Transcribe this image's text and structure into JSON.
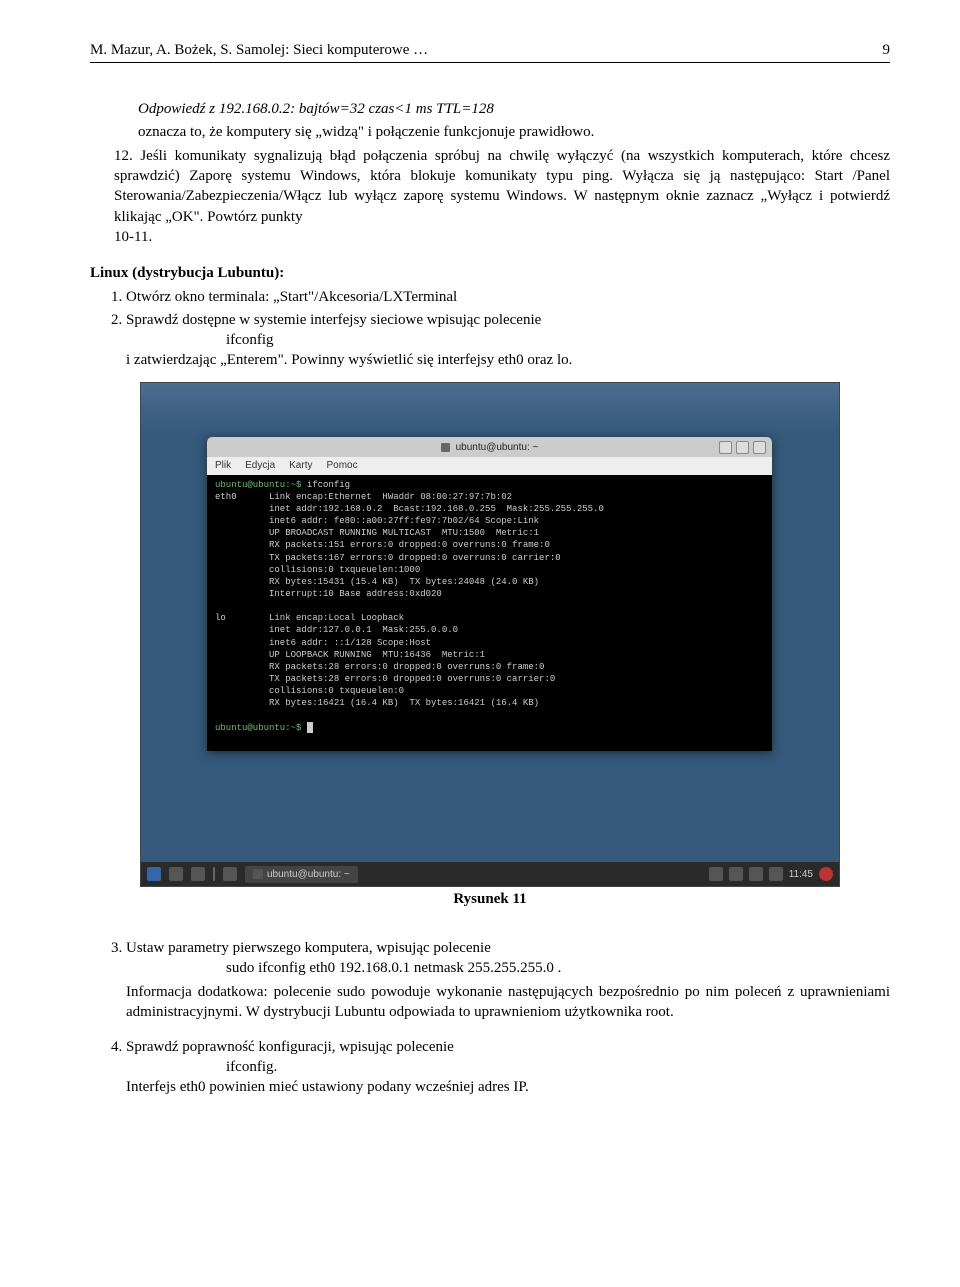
{
  "header": {
    "left": "M. Mazur, A. Bożek, S. Samolej: Sieci komputerowe …",
    "right": "9"
  },
  "block12": {
    "line1": "Odpowiedź z 192.168.0.2: bajtów=32 czas<1 ms TTL=128",
    "line2": "oznacza to, że komputery się „widzą\" i połączenie funkcjonuje prawidłowo.",
    "para": "12. Jeśli komunikaty sygnalizują błąd połączenia spróbuj na chwilę wyłączyć (na wszystkich komputerach, które chcesz sprawdzić) Zaporę systemu Windows, która blokuje komunikaty typu ping. Wyłącza się ją następująco: Start /Panel Sterowania/Zabezpieczenia/Włącz lub wyłącz zaporę systemu Windows. W następnym oknie zaznacz „Wyłącz i potwierdź klikając „OK\". Powtórz punkty",
    "para_end": "10-11."
  },
  "linux_title": "Linux (dystrybucja Lubuntu):",
  "list1": {
    "item1": "Otwórz okno terminala: „Start\"/Akcesoria/LXTerminal",
    "item2a": "Sprawdź dostępne w systemie interfejsy sieciowe wpisując polecenie",
    "item2_cmd": "ifconfig",
    "item2b": " i zatwierdzając „Enterem\". Powinny wyświetlić się interfejsy eth0 oraz lo."
  },
  "terminal": {
    "title": "ubuntu@ubuntu: ~",
    "menu": [
      "Plik",
      "Edycja",
      "Karty",
      "Pomoc"
    ],
    "prompt1": "ubuntu@ubuntu:~$ ",
    "cmd1": "ifconfig",
    "eth0_lines": "eth0      Link encap:Ethernet  HWaddr 08:00:27:97:7b:02\n          inet addr:192.168.0.2  Bcast:192.168.0.255  Mask:255.255.255.0\n          inet6 addr: fe80::a00:27ff:fe97:7b02/64 Scope:Link\n          UP BROADCAST RUNNING MULTICAST  MTU:1500  Metric:1\n          RX packets:151 errors:0 dropped:0 overruns:0 frame:0\n          TX packets:167 errors:0 dropped:0 overruns:0 carrier:0\n          collisions:0 txqueuelen:1000\n          RX bytes:15431 (15.4 KB)  TX bytes:24048 (24.0 KB)\n          Interrupt:10 Base address:0xd020",
    "lo_lines": "lo        Link encap:Local Loopback\n          inet addr:127.0.0.1  Mask:255.0.0.0\n          inet6 addr: ::1/128 Scope:Host\n          UP LOOPBACK RUNNING  MTU:16436  Metric:1\n          RX packets:28 errors:0 dropped:0 overruns:0 frame:0\n          TX packets:28 errors:0 dropped:0 overruns:0 carrier:0\n          collisions:0 txqueuelen:0\n          RX bytes:16421 (16.4 KB)  TX bytes:16421 (16.4 KB)",
    "prompt2": "ubuntu@ubuntu:~$ "
  },
  "taskbar": {
    "task_label": "ubuntu@ubuntu: ~",
    "clock": "11:45"
  },
  "caption": "Rysunek 11",
  "item3": {
    "lead": "Ustaw parametry pierwszego komputera, wpisując polecenie",
    "cmd": "sudo ifconfig eth0 192.168.0.1 netmask 255.255.255.0 .",
    "info": "Informacja dodatkowa: polecenie sudo powoduje wykonanie następujących bezpośrednio po nim poleceń z uprawnieniami administracyjnymi. W dystrybucji Lubuntu odpowiada to uprawnieniom użytkownika root."
  },
  "item4": {
    "lead": "Sprawdź poprawność konfiguracji, wpisując polecenie",
    "cmd": "ifconfig.",
    "tail": "Interfejs eth0 powinien mieć ustawiony podany wcześniej adres IP."
  }
}
